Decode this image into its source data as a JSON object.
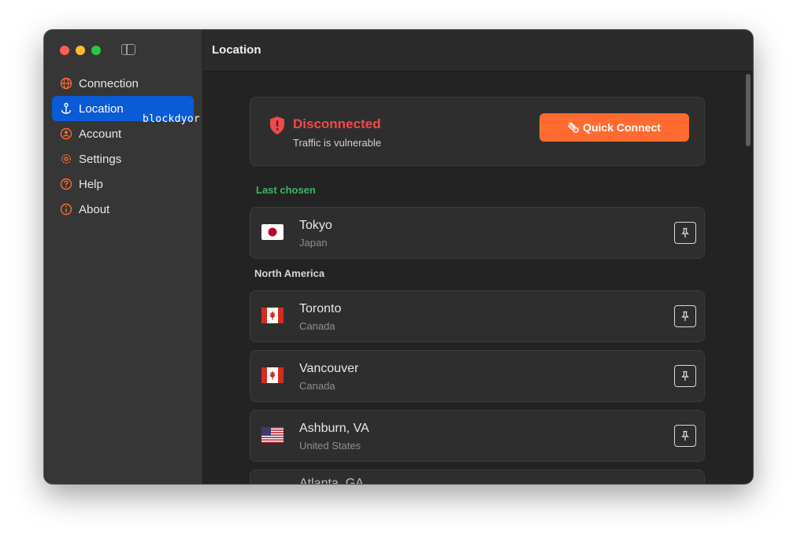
{
  "window": {
    "title": "Location"
  },
  "sidebar": {
    "items": [
      {
        "label": "Connection",
        "icon": "globe-icon",
        "active": false
      },
      {
        "label": "Location",
        "icon": "anchor-icon",
        "active": true
      },
      {
        "label": "Account",
        "icon": "user-icon",
        "active": false
      },
      {
        "label": "Settings",
        "icon": "gear-icon",
        "active": false
      },
      {
        "label": "Help",
        "icon": "question-icon",
        "active": false
      },
      {
        "label": "About",
        "icon": "info-icon",
        "active": false
      }
    ],
    "watermark": "blockdyor"
  },
  "status": {
    "title": "Disconnected",
    "subtitle": "Traffic is vulnerable",
    "quick_connect": "Quick Connect",
    "color": "#f2494b",
    "button_color": "#ff6a30"
  },
  "sections": {
    "last_chosen": "Last chosen",
    "north_america": "North America"
  },
  "last_chosen": [
    {
      "city": "Tokyo",
      "country": "Japan",
      "flag": "jp"
    }
  ],
  "north_america": [
    {
      "city": "Toronto",
      "country": "Canada",
      "flag": "ca"
    },
    {
      "city": "Vancouver",
      "country": "Canada",
      "flag": "ca"
    },
    {
      "city": "Ashburn, VA",
      "country": "United States",
      "flag": "us"
    },
    {
      "city": "Atlanta, GA",
      "country": "",
      "flag": "us"
    }
  ],
  "colors": {
    "accent": "#0a5bd6",
    "icon_orange": "#ff6a30",
    "green_label": "#3fb46a"
  }
}
